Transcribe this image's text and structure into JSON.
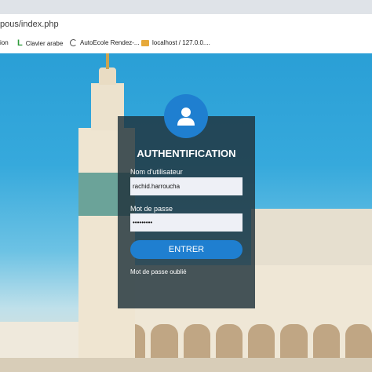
{
  "browser": {
    "address": "pous/index.php",
    "bookmarks": [
      {
        "label": "ion",
        "icon": "bookmark-icon"
      },
      {
        "label": "Clavier arabe",
        "icon": "letter-l-icon"
      },
      {
        "label": "AutoEcole Rendez-...",
        "icon": "c-logo-icon"
      },
      {
        "label": "localhost / 127.0.0....",
        "icon": "folder-icon"
      }
    ]
  },
  "login": {
    "title": "AUTHENTIFICATION",
    "username_label": "Nom d'utilisateur",
    "username_value": "rachid.harroucha",
    "password_label": "Mot de passe",
    "password_value": "•••••••••",
    "submit_label": "ENTRER",
    "forgot_label": "Mot de passe oublié"
  },
  "colors": {
    "accent": "#1f7fd0",
    "panel": "#20323a",
    "field": "#eef0f6"
  }
}
